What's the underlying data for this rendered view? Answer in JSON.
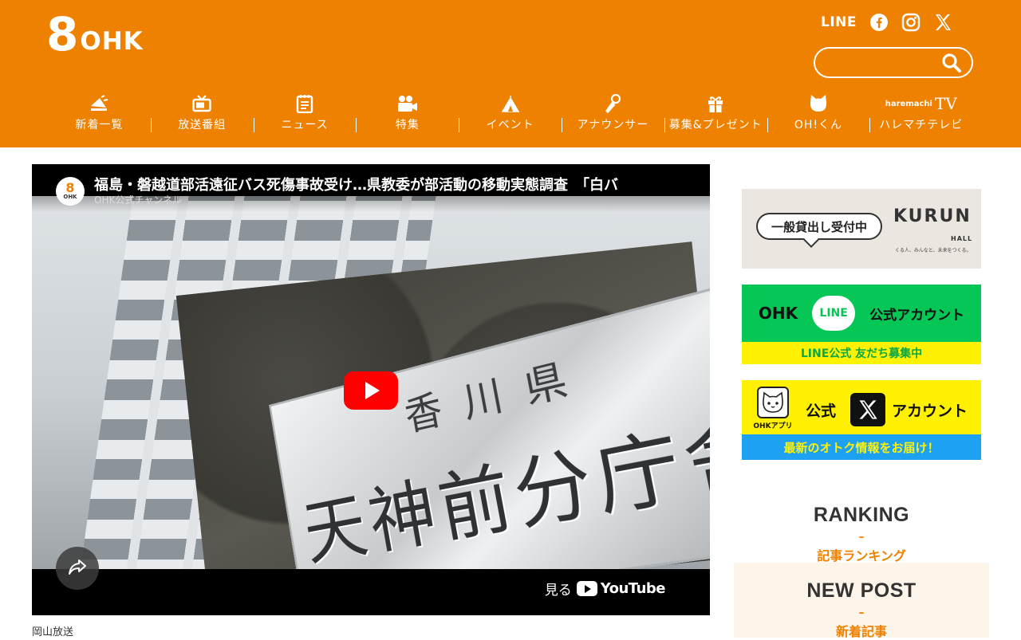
{
  "header": {
    "logo_num": "8",
    "logo_text": "OHK",
    "social": {
      "line": "LINE",
      "facebook_icon": "facebook-icon",
      "instagram_icon": "instagram-icon",
      "x_icon": "x-icon"
    },
    "search": {
      "placeholder": "",
      "icon": "search-icon"
    },
    "nav": [
      {
        "label": "新着一覧",
        "icon": "megaphone-icon"
      },
      {
        "label": "放送番組",
        "icon": "tv-icon"
      },
      {
        "label": "ニュース",
        "icon": "notepad-icon"
      },
      {
        "label": "特集",
        "icon": "camera-icon"
      },
      {
        "label": "イベント",
        "icon": "tent-icon"
      },
      {
        "label": "アナウンサー",
        "icon": "microphone-icon"
      },
      {
        "label": "募集&プレゼント",
        "icon": "gift-icon"
      },
      {
        "label": "OH!くん",
        "icon": "mascot-icon"
      },
      {
        "label": "ハレマチテレビ",
        "brand_small": "haremachi",
        "brand_tv": "TV"
      }
    ]
  },
  "video": {
    "title": "福島・磐越道部活遠征バス死傷事故受け…県教委が部活動の移動実態調査　「白バ",
    "channel": "OHK公式チャンネル",
    "avatar_num": "8",
    "avatar_text": "OHK",
    "sign_top": "香川県",
    "sign_main": "天神前分庁舎",
    "watch_on": "見る",
    "youtube": "YouTube"
  },
  "caption": "岡山放送",
  "sidebar": {
    "kurun": {
      "bubble": "一般貸出し受付中",
      "logo": "KURUN",
      "hall": "HALL",
      "tagline": "くる人、みんなと、未来をつくる。"
    },
    "line_banner": {
      "ohk": "OHK",
      "line": "LINE",
      "official": "公式アカウント",
      "strip": "LINE公式 友だち募集中"
    },
    "x_banner": {
      "app_label": "OHKアプリ",
      "official": "公式",
      "account": "アカウント",
      "strip": "最新のオトク情報をお届け！"
    },
    "ranking": {
      "title": "RANKING",
      "dash": "–",
      "sub": "記事ランキング"
    },
    "newpost": {
      "title": "NEW POST",
      "dash": "–",
      "sub": "新着記事"
    }
  }
}
